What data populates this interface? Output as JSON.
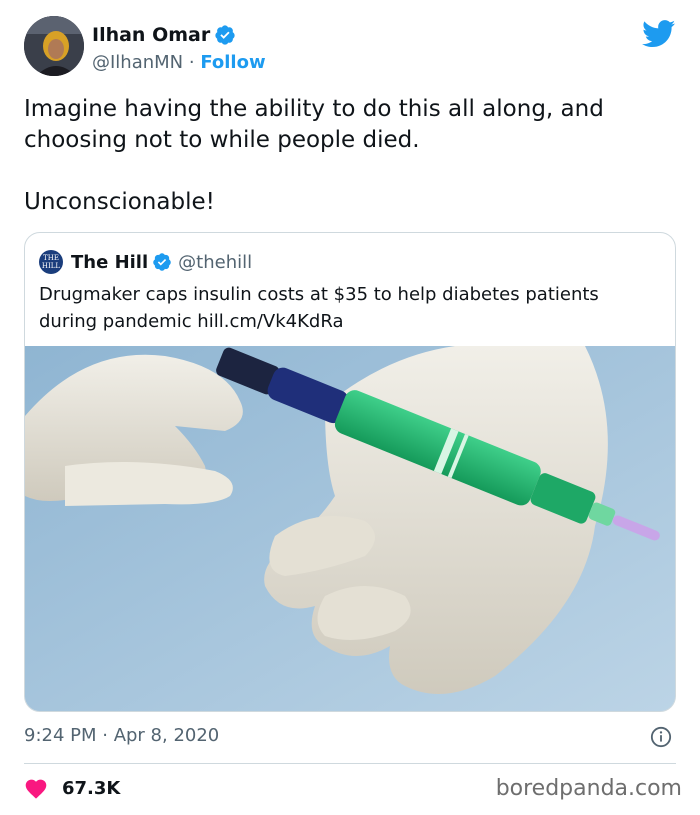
{
  "author": {
    "display_name": "Ilhan Omar",
    "handle": "@IlhanMN",
    "separator": " · ",
    "follow_label": "Follow",
    "verified": true
  },
  "tweet": {
    "text": "Imagine having the ability to do this all along, and choosing not to while people died.\n\nUnconscionable!",
    "timestamp": "9:24 PM · Apr 8, 2020",
    "likes": "67.3K"
  },
  "quoted_tweet": {
    "logo_text_top": "THE",
    "logo_text_bottom": "HILL",
    "display_name": "The Hill",
    "handle": "@thehill",
    "verified": true,
    "text": "Drugmaker caps insulin costs at $35 to help diabetes patients during pandemic hill.cm/Vk4KdRa",
    "image_description_icon": "insulin-pen-photo"
  },
  "watermark": "boredpanda.com",
  "colors": {
    "accent": "#1d9bf0",
    "heart": "#f91880",
    "text": "#0f1419",
    "secondary": "#536471",
    "border": "#cfd9de"
  }
}
